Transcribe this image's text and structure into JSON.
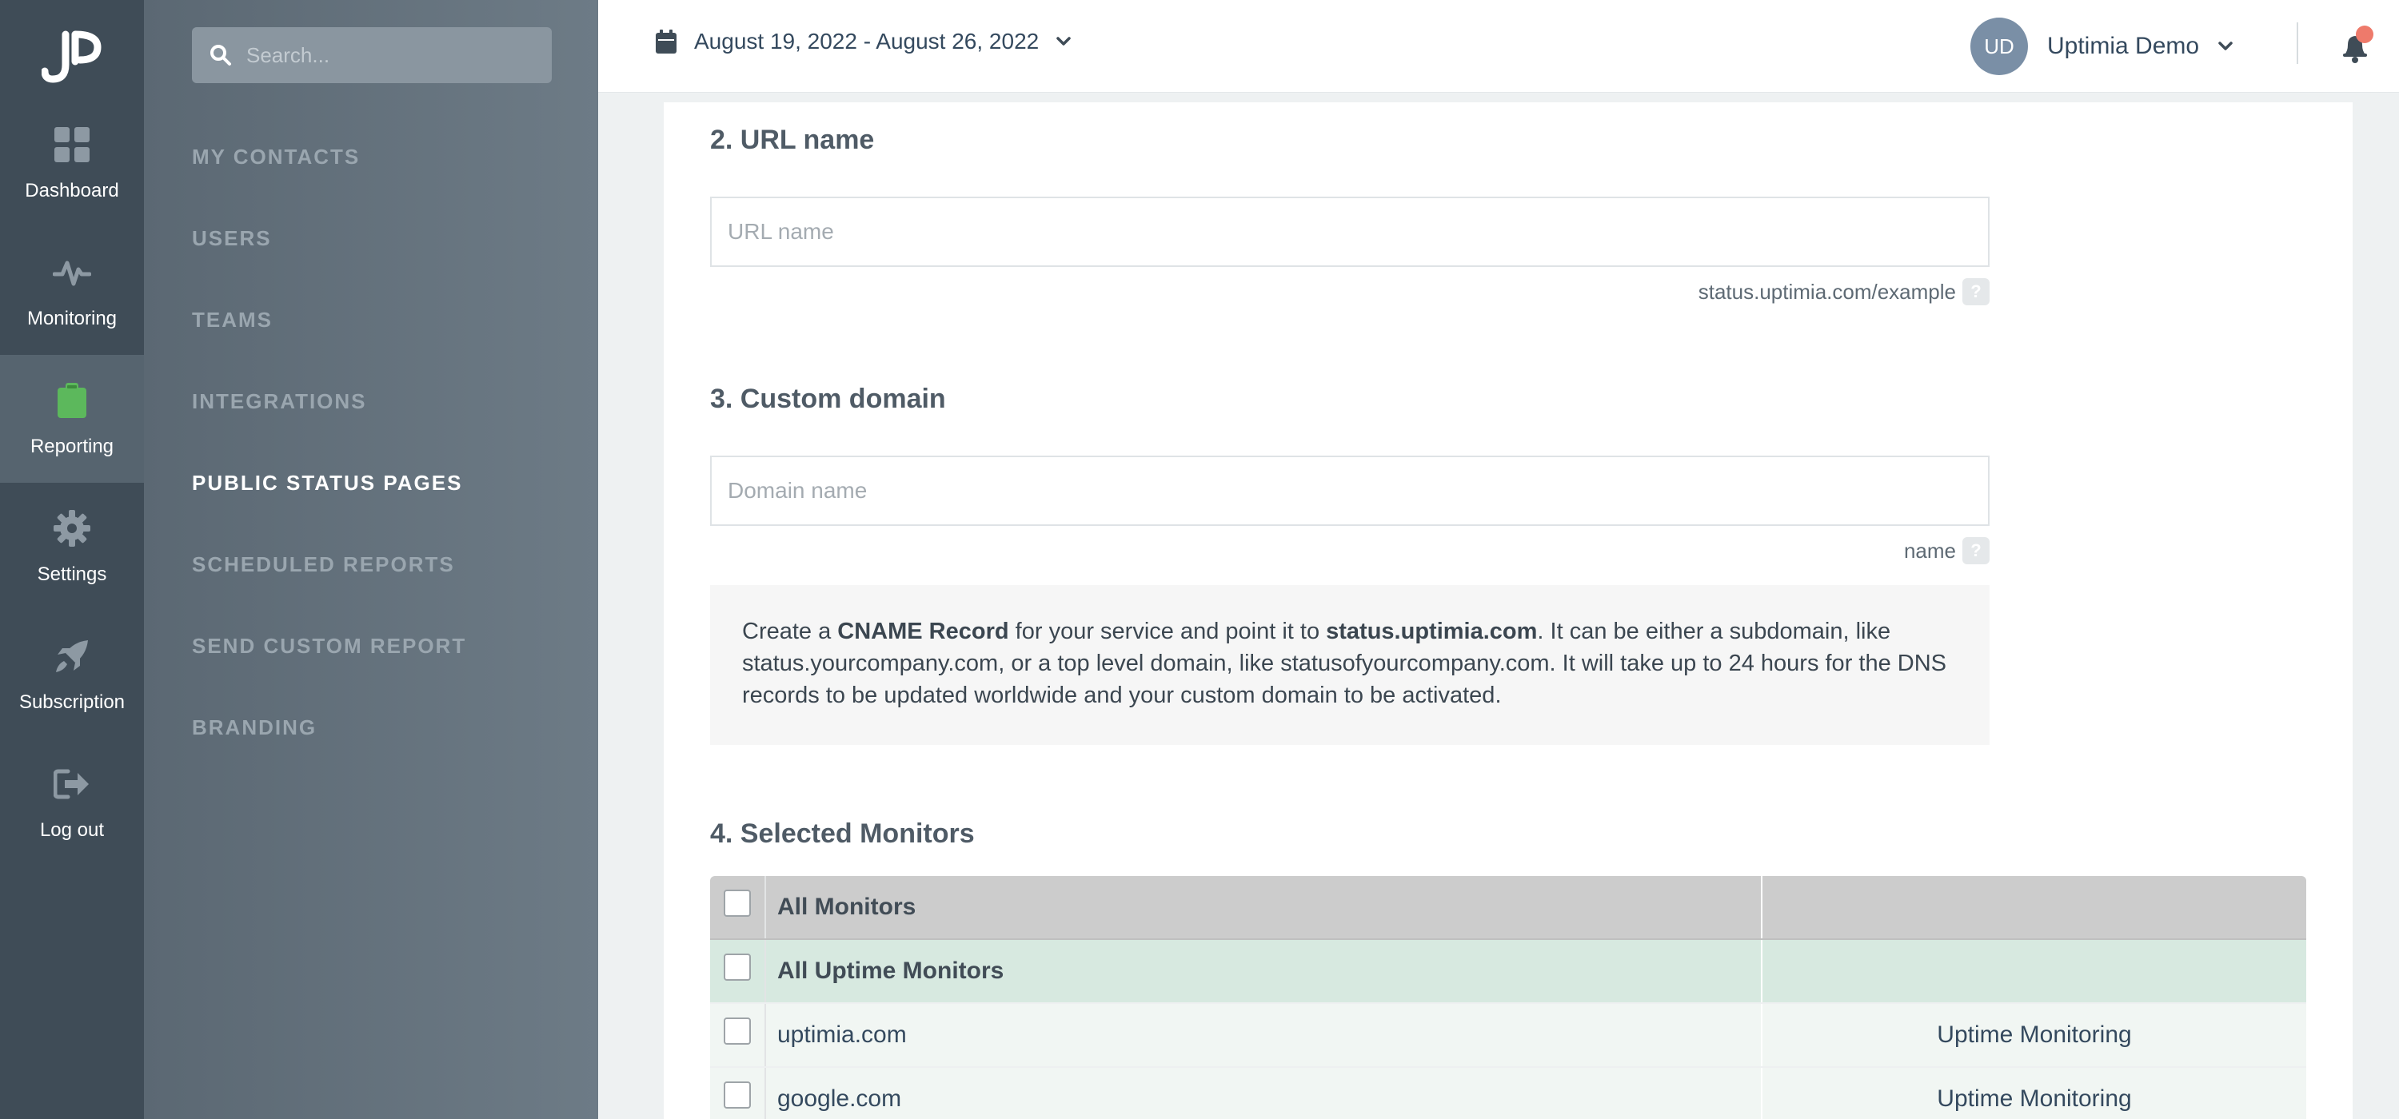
{
  "rail": {
    "items": [
      {
        "label": "Dashboard",
        "icon": "dashboard-grid-icon"
      },
      {
        "label": "Monitoring",
        "icon": "pulse-icon"
      },
      {
        "label": "Reporting",
        "icon": "clipboard-icon",
        "active": true
      },
      {
        "label": "Settings",
        "icon": "gear-icon"
      },
      {
        "label": "Subscription",
        "icon": "rocket-icon"
      },
      {
        "label": "Log out",
        "icon": "logout-icon"
      }
    ]
  },
  "submenu": {
    "search_placeholder": "Search...",
    "items": [
      {
        "label": "MY CONTACTS"
      },
      {
        "label": "USERS"
      },
      {
        "label": "TEAMS"
      },
      {
        "label": "INTEGRATIONS"
      },
      {
        "label": "PUBLIC STATUS PAGES",
        "active": true
      },
      {
        "label": "SCHEDULED REPORTS"
      },
      {
        "label": "SEND CUSTOM REPORT"
      },
      {
        "label": "BRANDING"
      }
    ]
  },
  "header": {
    "date_range": "August 19, 2022 - August 26, 2022",
    "user_initials": "UD",
    "user_name": "Uptimia Demo"
  },
  "form": {
    "url_section": {
      "title": "2. URL name",
      "placeholder": "URL name",
      "hint": "status.uptimia.com/example"
    },
    "domain_section": {
      "title": "3. Custom domain",
      "placeholder": "Domain name",
      "hint": "name"
    },
    "info": {
      "t1": "Create a ",
      "b1": "CNAME Record",
      "t2": " for your service and point it to ",
      "b2": "status.uptimia.com",
      "t3": ". It can be either a subdomain, like status.yourcompany.com, or a top level domain, like statusofyourcompany.com. It will take up to 24 hours for the DNS records to be updated worldwide and your custom domain to be activated."
    },
    "monitors_section": {
      "title": "4. Selected Monitors",
      "header": "All Monitors",
      "group": "All Uptime Monitors",
      "rows": [
        {
          "name": "uptimia.com",
          "type": "Uptime Monitoring"
        },
        {
          "name": "google.com",
          "type": "Uptime Monitoring"
        }
      ]
    }
  },
  "colors": {
    "rail_bg": "#3f4c57",
    "rail_active": "#56646f",
    "reporting_icon": "#5cb85c",
    "notification_dot": "#ee7a6b",
    "group_row": "#d7e9e0"
  }
}
